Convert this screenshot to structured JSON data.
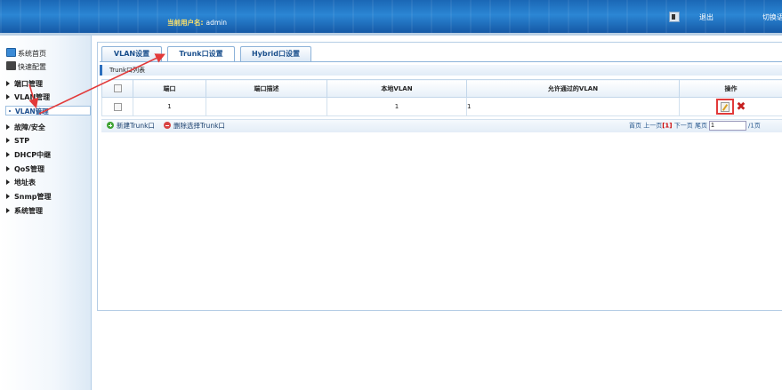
{
  "header": {
    "user_label": "当前用户名:",
    "user_name": "admin",
    "logout": "退出",
    "switch": "切换语"
  },
  "sidebar": {
    "top_items": [
      "系统首页",
      "快速配置"
    ],
    "groups": [
      {
        "label": "端口管理"
      },
      {
        "label": "VLAN管理"
      },
      {
        "label": "故障/安全"
      },
      {
        "label": "STP"
      },
      {
        "label": "DHCP中继"
      },
      {
        "label": "QoS管理"
      },
      {
        "label": "地址表"
      },
      {
        "label": "Snmp管理"
      },
      {
        "label": "系统管理"
      }
    ],
    "active_sub": "VLAN管理"
  },
  "tabs": [
    "VLAN设置",
    "Trunk口设置",
    "Hybrid口设置"
  ],
  "active_tab": 1,
  "list_title": "Trunk口列表",
  "table": {
    "headers": [
      "",
      "端口",
      "端口描述",
      "本地VLAN",
      "允许通过的VLAN",
      "操作"
    ],
    "rows": [
      {
        "port": "1",
        "desc": "",
        "local_vlan": "1",
        "allowed_vlan": "1"
      }
    ]
  },
  "toolbar": {
    "add": "新建Trunk口",
    "delete": "删除选择Trunk口"
  },
  "pager": {
    "first": "首页",
    "prev": "上一页",
    "current": "[1]",
    "next": "下一页",
    "last": "尾页",
    "input_value": "1",
    "total": "/1页"
  },
  "colors": {
    "header": "#1f74c4",
    "accent": "#2c6fbd",
    "annotation": "#e23a3a"
  }
}
